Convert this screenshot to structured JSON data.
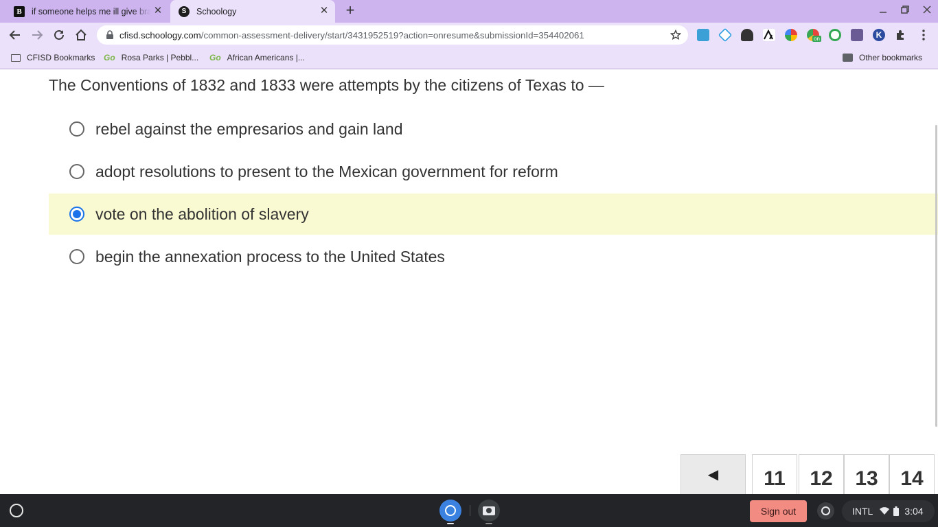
{
  "browser": {
    "tabs": [
      {
        "title": "if someone helps me ill give brainliest",
        "icon": "brainly-icon"
      },
      {
        "title": "Schoology",
        "icon": "schoology-icon",
        "active": true
      }
    ],
    "url": {
      "host": "cfisd.schoology.com",
      "path": "/common-assessment-delivery/start/3431952519?action=onresume&submissionId=354402061"
    },
    "bookmarks": [
      {
        "label": "CFISD Bookmarks",
        "icon": "folder-icon"
      },
      {
        "label": "Rosa Parks | Pebbl...",
        "icon": "goguardian-icon",
        "prefix": "Go"
      },
      {
        "label": "African Americans |...",
        "icon": "goguardian-icon",
        "prefix": "Go"
      }
    ],
    "other_bookmarks": "Other bookmarks"
  },
  "assessment": {
    "question": "The Conventions of 1832 and 1833 were attempts by the citizens of Texas to —",
    "choices": [
      {
        "label": "rebel against the empresarios and gain land",
        "selected": false
      },
      {
        "label": "adopt resolutions to present to the Mexican government for reform",
        "selected": false
      },
      {
        "label": "vote on the abolition of slavery",
        "selected": true
      },
      {
        "label": "begin the annexation process to the United States",
        "selected": false
      }
    ],
    "pager": {
      "prev_icon": "◀",
      "pages": [
        "11",
        "12",
        "13",
        "14"
      ]
    }
  },
  "shelf": {
    "sign_out": "Sign out",
    "keyboard_layout": "INTL",
    "time": "3:04"
  },
  "colors": {
    "tab_strip": "#cdb4ef",
    "toolbar": "#ece1fa",
    "selected_choice_bg": "#fafad2",
    "radio_checked": "#1a73e8",
    "sign_out_bg": "#f28b82",
    "shelf": "#232428"
  }
}
